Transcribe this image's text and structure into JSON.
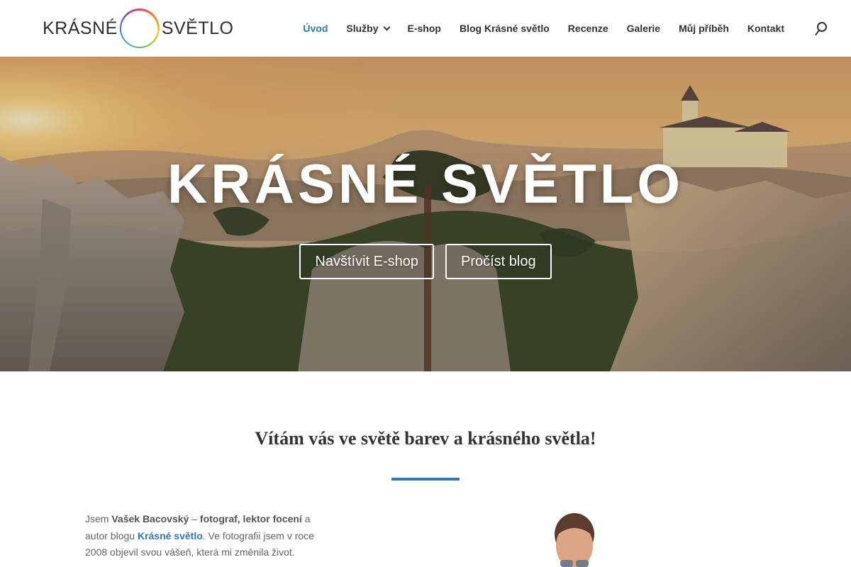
{
  "header": {
    "logo_left": "KRÁSNÉ",
    "logo_right": "SVĚTLO",
    "nav": [
      {
        "label": "Úvod",
        "active": true
      },
      {
        "label": "Služby",
        "has_dropdown": true
      },
      {
        "label": "E-shop"
      },
      {
        "label": "Blog Krásné světlo"
      },
      {
        "label": "Recenze"
      },
      {
        "label": "Galerie"
      },
      {
        "label": "Můj příběh"
      },
      {
        "label": "Kontakt"
      }
    ],
    "search_icon": "search-icon"
  },
  "hero": {
    "title": "KRÁSNÉ SVĚTLO",
    "buttons": [
      {
        "label": "Navštívit E-shop"
      },
      {
        "label": "Pročíst blog"
      }
    ]
  },
  "content": {
    "welcome_heading": "Vítám vás ve světě barev a krásného světla!",
    "intro": {
      "t1": "Jsem ",
      "name": "Vašek Bacovský",
      "t2": " – ",
      "role": "fotograf, lektor focení",
      "t3": " a autor blogu ",
      "blog_link": "Krásné světlo",
      "t4": ". Ve fotografii jsem v roce 2008 objevil svou vášeň, která mi změnila život."
    }
  },
  "colors": {
    "accent": "#2a7bb5",
    "nav_text": "#333333",
    "body_text": "#666666"
  }
}
